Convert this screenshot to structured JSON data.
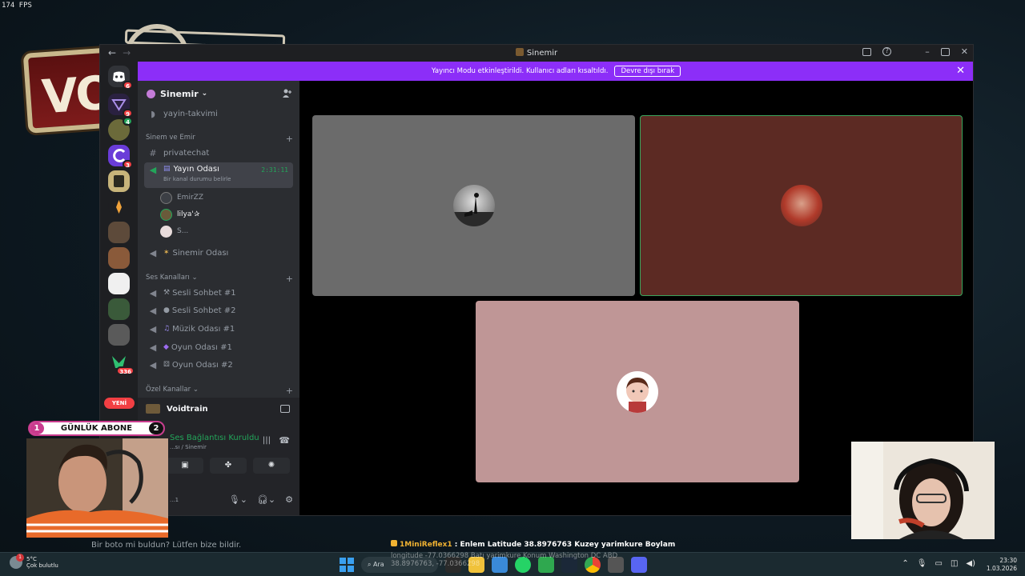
{
  "fps": "174 FPS",
  "game_art_text": "VO",
  "window": {
    "title": "Sinemir",
    "back_icon": "←",
    "forward_icon": "→"
  },
  "banner": {
    "text": "Yayıncı Modu etkinleştirildi. Kullanıcı adları kısaltıldı.",
    "button": "Devre dışı bırak",
    "close": "✕",
    "color": "#8c2ef8"
  },
  "rail": {
    "badges": {
      "discord": "6",
      "s2": "9",
      "s3": "4",
      "s4": "3",
      "s13": "336"
    },
    "new_pill": "YENİ"
  },
  "server": {
    "name": "Sinemir",
    "channels_top": [
      {
        "label": "yayin-takvimi"
      }
    ],
    "cat1": "Sinem ve Emir",
    "privatechat": "privatechat",
    "active_channel": {
      "label": "Yayın Odası",
      "status": "Bir kanal durumu belirle",
      "timer": "2:31:11"
    },
    "users": [
      "EmirZZ",
      "lilya'✰",
      "S..."
    ],
    "sinemir_room": "Sinemir Odası",
    "cat2": "Ses Kanalları",
    "voice_channels": [
      "Sesli Sohbet #1",
      "Sesli Sohbet #2",
      "Müzik Odası #1",
      "Oyun Odası #1",
      "Oyun Odası #2"
    ],
    "cat3": "Özel Kanallar"
  },
  "user_panel": {
    "game": "Voidtrain",
    "connection": "Ses Bağlantısı Kuruldu",
    "sub": "...sı / Sinemir",
    "uid": "...1"
  },
  "stage": {
    "tiles": [
      {
        "bg": "#6b6b6b",
        "border": "none"
      },
      {
        "bg": "#5c2a23",
        "border": "#3ba55d"
      },
      {
        "bg": "#bf9696",
        "border": "none"
      }
    ]
  },
  "overlay": {
    "sub_goal": {
      "left": "1",
      "label": "GÜNLÜK ABONE",
      "right": "2"
    },
    "bot_text": "Bir boto mi buldun? Lütfen bize bildir.",
    "ticker_name": "1MiniReflex1",
    "ticker_text": " : Enlem Latitude 38.8976763 Kuzey yarimkure Boylam",
    "ticker_line2": "longitude -77.0366298 Batı yarimkure Konum Washington DC ABD",
    "ticker_line3": "38.8976763, -77.0366298"
  },
  "taskbar": {
    "temp": "5°C",
    "weather": "Çok bulutlu",
    "weather_badge": "1",
    "search": "Ara",
    "time": "23:30",
    "date": "1.03.2026"
  }
}
